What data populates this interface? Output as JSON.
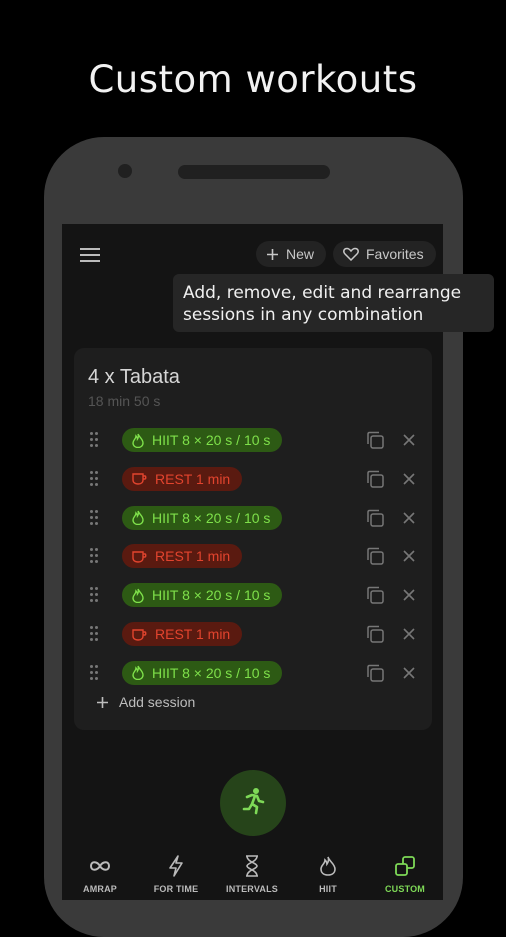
{
  "headline": "Custom workouts",
  "toolbar": {
    "new_label": "New",
    "favorites_label": "Favorites"
  },
  "tooltip": {
    "line1": "Add, remove, edit and rearrange",
    "line2": "sessions in any combination"
  },
  "workout": {
    "title": "4 x Tabata",
    "duration": "18 min 50 s",
    "sessions": [
      {
        "type": "hiit",
        "label": "HIIT 8 × 20 s / 10 s"
      },
      {
        "type": "rest",
        "label": "REST 1 min"
      },
      {
        "type": "hiit",
        "label": "HIIT 8 × 20 s / 10 s"
      },
      {
        "type": "rest",
        "label": "REST 1 min"
      },
      {
        "type": "hiit",
        "label": "HIIT 8 × 20 s / 10 s"
      },
      {
        "type": "rest",
        "label": "REST 1 min"
      },
      {
        "type": "hiit",
        "label": "HIIT 8 × 20 s / 10 s"
      }
    ],
    "add_session_label": "Add session"
  },
  "tabs": [
    {
      "label": "AMRAP",
      "icon": "infinity-icon",
      "active": false
    },
    {
      "label": "FOR TIME",
      "icon": "lightning-icon",
      "active": false
    },
    {
      "label": "INTERVALS",
      "icon": "hourglass-icon",
      "active": false
    },
    {
      "label": "HIIT",
      "icon": "flame-icon",
      "active": false
    },
    {
      "label": "CUSTOM",
      "icon": "custom-shapes-icon",
      "active": true
    }
  ],
  "colors": {
    "hiit_text": "#7ee04a",
    "hiit_bg": "#2d5a14",
    "rest_text": "#e2442e",
    "rest_bg": "#5a1a10",
    "accent": "#7ed957"
  }
}
